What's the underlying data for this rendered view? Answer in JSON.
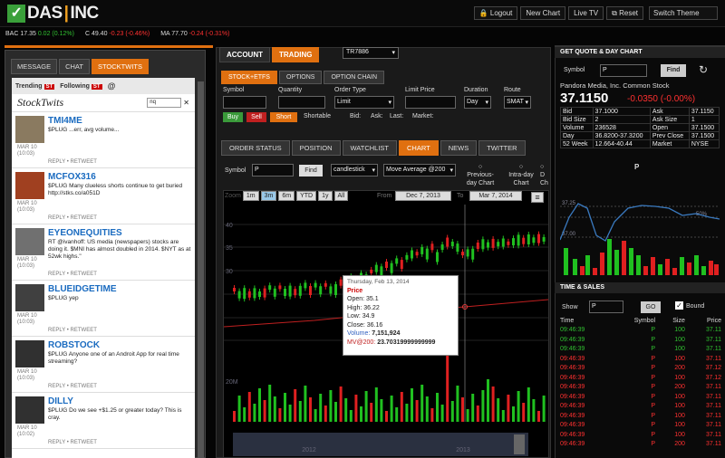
{
  "app": {
    "logo_left": "DAS",
    "logo_right": "INC"
  },
  "top_buttons": [
    "Logout",
    "New Chart",
    "Live TV",
    "Reset"
  ],
  "switch_theme": "Switch Theme",
  "ticker": [
    {
      "sym": "BAC",
      "price": "17.35",
      "chg": "0.02 (0.12%)",
      "dir": "pos"
    },
    {
      "sym": "C",
      "price": "49.40",
      "chg": "-0.23 (-0.46%)",
      "dir": "neg"
    },
    {
      "sym": "MA",
      "price": "77.70",
      "chg": "-0.24 (-0.31%)",
      "dir": "neg"
    }
  ],
  "left_tabs": [
    "MESSAGE",
    "CHAT",
    "STOCKTWITS"
  ],
  "stocktwits": {
    "trending": "Trending",
    "following": "Following",
    "badge": "ST",
    "logo": "StockTwits",
    "search": "nq",
    "messages": [
      {
        "name": "TMI4ME",
        "date": "MAR 10",
        "time": "(10:03)",
        "text": "$PLUG ...err, avg volume...",
        "actions": "REPLY • RETWEET"
      },
      {
        "name": "MCFOX316",
        "date": "MAR 10",
        "time": "(10:03)",
        "text": "$PLUG Many clueless shorts continue to get buried http://stks.co/a051D",
        "actions": "REPLY • RETWEET"
      },
      {
        "name": "EYEONEQUITIES",
        "date": "MAR 10",
        "time": "(10:03)",
        "text": "RT @ivanhoff: US media (newspapers) stocks are doing it. $MNI has almost doubled in 2014. $NYT as at 52wk highs.\"",
        "actions": "REPLY • RETWEET"
      },
      {
        "name": "BLUEIDGETIME",
        "date": "MAR 10",
        "time": "(10:03)",
        "text": "$PLUG yep",
        "actions": "REPLY • RETWEET"
      },
      {
        "name": "ROBSTOCK",
        "date": "MAR 10",
        "time": "(10:03)",
        "text": "$PLUG Anyone one of an Androit App for real time streaming?",
        "actions": "REPLY • RETWEET"
      },
      {
        "name": "DILLY",
        "date": "MAR 10",
        "time": "(10:02)",
        "text": "$PLUG Do we see +$1.25 or greater today? This is cray.",
        "actions": "REPLY • RETWEET"
      }
    ]
  },
  "account_tabs": [
    "ACCOUNT",
    "TRADING"
  ],
  "account_select": "TR7886",
  "sub_tabs": [
    "STOCK+ETFS",
    "OPTIONS",
    "OPTION CHAIN"
  ],
  "order_form": {
    "labels": [
      "Symbol",
      "Quantity",
      "Order Type",
      "Limit Price",
      "Duration",
      "Route"
    ],
    "order_type": "Limit",
    "duration": "Day",
    "route": "SMAT",
    "buy": "Buy",
    "sell": "Sell",
    "short": "Short",
    "shortable": "Shortable",
    "bid": "Bid:",
    "ask": "Ask:",
    "last": "Last:",
    "market": "Market:"
  },
  "chart_tabs": [
    "ORDER STATUS",
    "POSITION",
    "WATCHLIST",
    "CHART",
    "NEWS",
    "TWITTER"
  ],
  "chart_controls": {
    "symbol_label": "Symbol",
    "symbol": "P",
    "find": "Find",
    "style": "candlestick",
    "indicator": "Move Average @200",
    "prev_day": "Previous-day Chart",
    "intra_day": "Intra-day Chart",
    "day": "D Ch"
  },
  "zoom": {
    "label": "Zoom",
    "options": [
      "1m",
      "3m",
      "6m",
      "YTD",
      "1y",
      "All"
    ],
    "from_label": "From",
    "from": "Dec 7, 2013",
    "to_label": "To",
    "to": "Mar 7, 2014"
  },
  "tooltip": {
    "date": "Thursday, Feb 13, 2014",
    "title": "Price",
    "open": "Open: 35.1",
    "high": "High: 36.22",
    "low": "Low: 34.9",
    "close": "Close: 36.16",
    "volume_label": "Volume:",
    "volume": "7,151,924",
    "ma_label": "MV@200:",
    "ma": "23.70319999999999"
  },
  "xaxis": [
    "16. Dec",
    "30. Dec",
    "13. Jan",
    "27. Jan",
    "10. Feb",
    "24. Feb"
  ],
  "years": [
    "2012",
    "2013"
  ],
  "yaxis": [
    "40",
    "35",
    "30"
  ],
  "vol_label": "20M",
  "quote": {
    "header": "GET QUOTE & DAY CHART",
    "symbol_label": "Symbol",
    "symbol": "P",
    "find": "Find",
    "name": "Pandora Media, Inc. Common Stock",
    "price": "37.1150",
    "change": "-0.0350 (-0.00%)",
    "rows": [
      [
        "Bid",
        "37.1000",
        "Ask",
        "37.1150"
      ],
      [
        "Bid Size",
        "2",
        "Ask Size",
        "1"
      ],
      [
        "Volume",
        "236528",
        "Open",
        "37.1500"
      ],
      [
        "Day",
        "36.8200-37.3200",
        "Prev Close",
        "37.1500"
      ],
      [
        "52 Week",
        "12.664-40.44",
        "Market",
        "NYSE"
      ]
    ],
    "chart_label": "P",
    "chart_ticks": [
      "37.25",
      "50%",
      "37.00"
    ]
  },
  "timesales": {
    "header": "TIME & SALES",
    "show_label": "Show",
    "symbol": "P",
    "go": "GO",
    "bound": "Bound",
    "columns": [
      "Time",
      "Symbol",
      "Size",
      "Price"
    ],
    "rows": [
      [
        "09:46:39",
        "P",
        "100",
        "37.11",
        "g"
      ],
      [
        "09:46:39",
        "P",
        "100",
        "37.11",
        "g"
      ],
      [
        "09:46:39",
        "P",
        "100",
        "37.11",
        "g"
      ],
      [
        "09:46:39",
        "P",
        "100",
        "37.11",
        "r"
      ],
      [
        "09:46:39",
        "P",
        "200",
        "37.12",
        "r"
      ],
      [
        "09:46:39",
        "P",
        "100",
        "37.12",
        "r"
      ],
      [
        "09:46:39",
        "P",
        "200",
        "37.11",
        "r"
      ],
      [
        "09:46:39",
        "P",
        "100",
        "37.11",
        "r"
      ],
      [
        "09:46:39",
        "P",
        "100",
        "37.11",
        "r"
      ],
      [
        "09:46:39",
        "P",
        "100",
        "37.11",
        "r"
      ],
      [
        "09:46:39",
        "P",
        "100",
        "37.11",
        "r"
      ],
      [
        "09:46:39",
        "P",
        "100",
        "37.11",
        "r"
      ],
      [
        "09:46:39",
        "P",
        "200",
        "37.11",
        "r"
      ]
    ]
  }
}
